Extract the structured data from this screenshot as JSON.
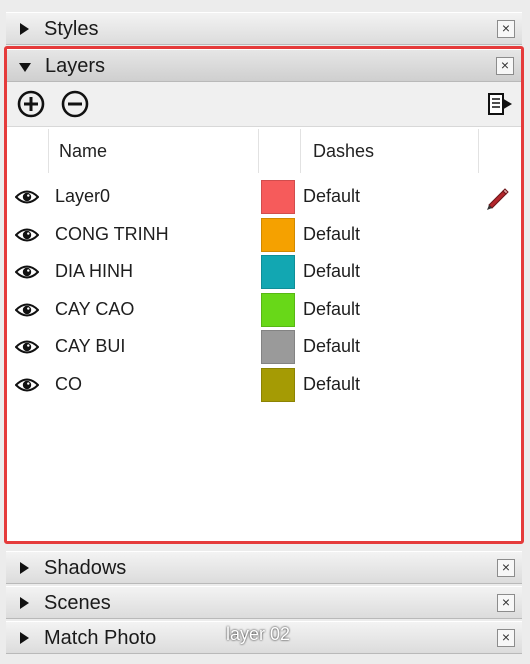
{
  "panels": {
    "styles": {
      "title": "Styles",
      "close": "×"
    },
    "layers": {
      "title": "Layers",
      "close": "×"
    },
    "shadows": {
      "title": "Shadows",
      "close": "×"
    },
    "scenes": {
      "title": "Scenes",
      "close": "×"
    },
    "match_photo": {
      "title": "Match Photo",
      "close": "×"
    }
  },
  "layers_table": {
    "headers": {
      "name": "Name",
      "dashes": "Dashes"
    },
    "rows": [
      {
        "name": "Layer0",
        "color": "#f65b5b",
        "dashes": "Default",
        "active": true
      },
      {
        "name": "CONG TRINH",
        "color": "#f5a100",
        "dashes": "Default",
        "active": false
      },
      {
        "name": "DIA HINH",
        "color": "#12a7b2",
        "dashes": "Default",
        "active": false
      },
      {
        "name": "CAY CAO",
        "color": "#68d818",
        "dashes": "Default",
        "active": false
      },
      {
        "name": "CAY BUI",
        "color": "#9a9a9a",
        "dashes": "Default",
        "active": false
      },
      {
        "name": "CO",
        "color": "#a59b04",
        "dashes": "Default",
        "active": false
      }
    ]
  },
  "icons": {
    "add_layer": "plus-circle-icon",
    "delete_layer": "minus-circle-icon",
    "details": "details-arrow-icon",
    "visibility": "eye-icon",
    "current_layer": "pencil-icon"
  },
  "caption": "layer 02"
}
